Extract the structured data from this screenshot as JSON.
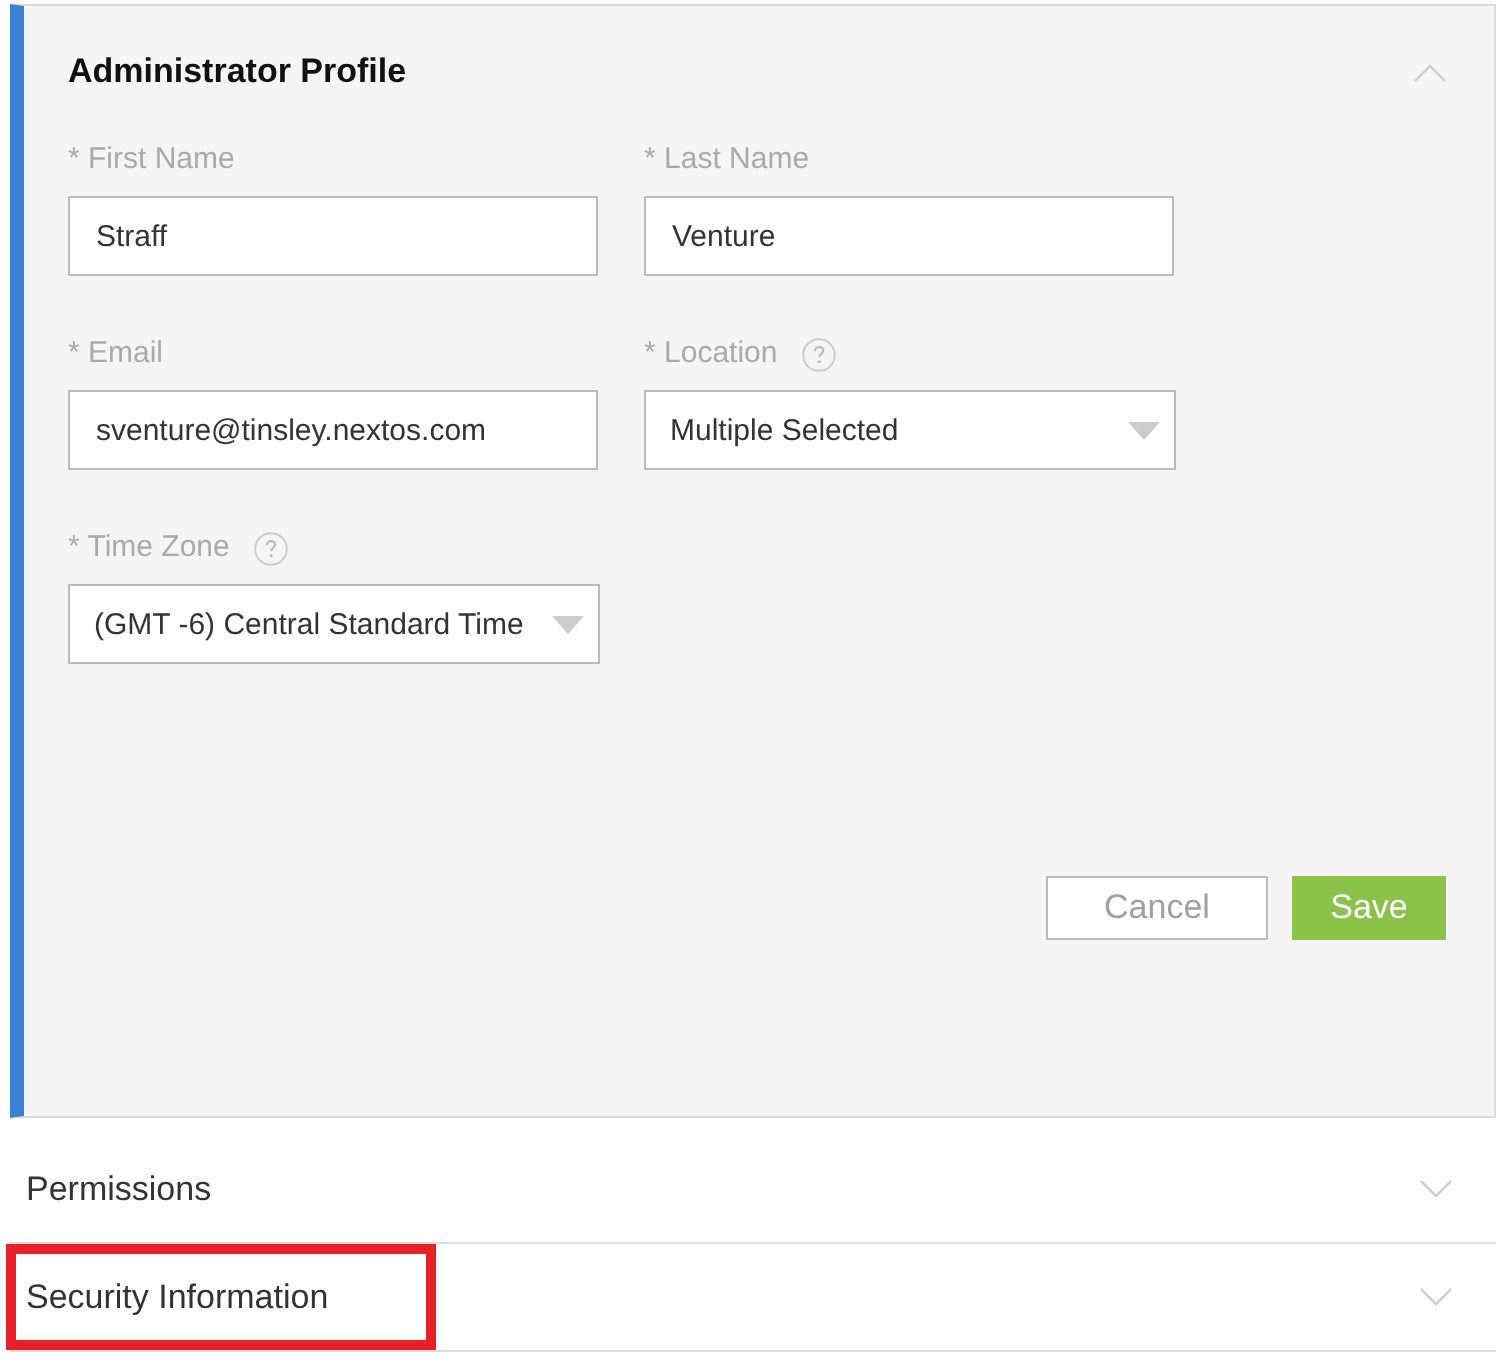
{
  "panel": {
    "title": "Administrator Profile",
    "expanded": true
  },
  "fields": [
    {
      "kind": "text",
      "label": "* First Name",
      "value": "Straff",
      "help": false
    },
    {
      "kind": "text",
      "label": "* Last Name",
      "value": "Venture",
      "help": false
    },
    {
      "kind": "text",
      "label": "* Email",
      "value": "sventure@tinsley.nextos.com",
      "help": false
    },
    {
      "kind": "select",
      "label": "* Location",
      "value": "Multiple Selected",
      "help": true
    },
    {
      "kind": "select",
      "label": "* Time Zone",
      "value": "(GMT -6) Central Standard Time",
      "help": true
    }
  ],
  "buttons": [
    {
      "kind": "secondary",
      "label": "Cancel"
    },
    {
      "kind": "primary",
      "label": "Save"
    }
  ],
  "sections": [
    {
      "title": "Permissions",
      "expanded": false,
      "highlighted": false
    },
    {
      "title": "Security Information",
      "expanded": false,
      "highlighted": true
    }
  ]
}
